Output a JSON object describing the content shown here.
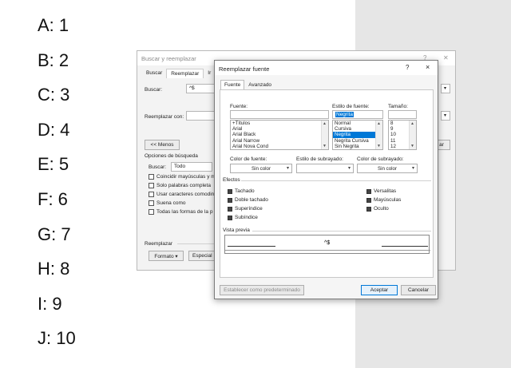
{
  "answers": [
    "A: 1",
    "B: 2",
    "C: 3",
    "D: 4",
    "E: 5",
    "F: 6",
    "G: 7",
    "H: 8",
    "I: 9",
    "J: 10"
  ],
  "back_dialog": {
    "title": "Buscar y reemplazar",
    "tabs": [
      "Buscar",
      "Reemplazar",
      "Ir"
    ],
    "find_label": "Buscar:",
    "find_value": "^$",
    "replace_label": "Reemplazar con:",
    "less_button": "<< Menos",
    "options_label": "Opciones de búsqueda",
    "search_label": "Buscar:",
    "search_value": "Todo",
    "options": [
      "Coincidir mayúsculas y m",
      "Solo palabras completa",
      "Usar caracteres comodin",
      "Suena como",
      "Todas las formas de la p"
    ],
    "replace_section": "Reemplazar",
    "format_button": "Formato ▾",
    "special_button": "Especial",
    "right_button": "ar"
  },
  "font_dialog": {
    "title": "Reemplazar fuente",
    "help": "?",
    "close": "×",
    "tabs": [
      "Fuente",
      "Avanzado"
    ],
    "font_label": "Fuente:",
    "font_value": "",
    "fonts": [
      "+Títulos",
      "Arial",
      "Arial Black",
      "Arial Narrow",
      "Arial Nova Cond"
    ],
    "style_label": "Estilo de fuente:",
    "style_value": "Negrita",
    "styles": [
      "Normal",
      "Cursiva",
      "Negrita",
      "Negrita Cursiva",
      "Sin Negrita"
    ],
    "size_label": "Tamaño:",
    "size_value": "",
    "sizes": [
      "8",
      "9",
      "10",
      "11",
      "12"
    ],
    "color_label": "Color de fuente:",
    "color_value": "Sin color",
    "underline_label": "Estilo de subrayado:",
    "underline_value": "",
    "underline_color_label": "Color de subrayado:",
    "underline_color_value": "Sin color",
    "effects_label": "Efectos",
    "effects_left": [
      "Tachado",
      "Doble tachado",
      "Superíndice",
      "Subíndice"
    ],
    "effects_right": [
      "Versalitas",
      "Mayúsculas",
      "Oculto"
    ],
    "preview_label": "Vista previa",
    "preview_text": "^$",
    "default_button": "Establecer como predeterminado",
    "ok_button": "Aceptar",
    "cancel_button": "Cancelar"
  }
}
